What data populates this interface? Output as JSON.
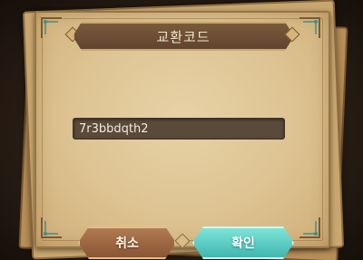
{
  "dialog": {
    "title": "교환코드",
    "code_value": "7r3bbdqth2"
  },
  "buttons": {
    "cancel_label": "취소",
    "confirm_label": "확인"
  },
  "colors": {
    "parchment": "#ddc392",
    "title_bar": "#6b4e35",
    "field_bg": "#5a4a3a",
    "cancel_button": "#9c6542",
    "confirm_button": "#5cd0c6"
  },
  "icons": [
    "corner-ornament-icon",
    "diamond-gem-icon"
  ]
}
